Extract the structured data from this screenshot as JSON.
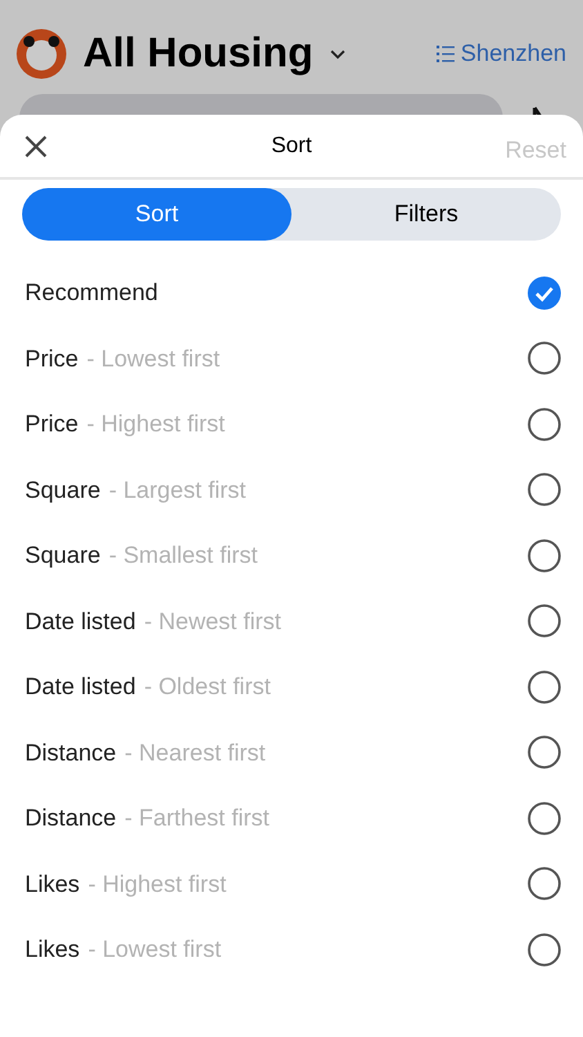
{
  "header": {
    "title": "All Housing",
    "city": "Shenzhen"
  },
  "sheet": {
    "title": "Sort",
    "reset": "Reset",
    "tabs": [
      {
        "label": "Sort",
        "selected": true
      },
      {
        "label": "Filters",
        "selected": false
      }
    ],
    "options": [
      {
        "label": "Recommend",
        "selected": true
      },
      {
        "label": "Price",
        "detail": "- Lowest first",
        "selected": false
      },
      {
        "label": "Price",
        "detail": "- Highest first",
        "selected": false
      },
      {
        "label": "Square",
        "detail": "- Largest first",
        "selected": false
      },
      {
        "label": "Square",
        "detail": "- Smallest first",
        "selected": false
      },
      {
        "label": "Date listed",
        "detail": "- Newest first",
        "selected": false
      },
      {
        "label": "Date listed",
        "detail": "- Oldest first",
        "selected": false
      },
      {
        "label": "Distance",
        "detail": "- Nearest first",
        "selected": false
      },
      {
        "label": "Distance",
        "detail": "- Farthest first",
        "selected": false
      },
      {
        "label": "Likes",
        "detail": "- Highest first",
        "selected": false
      },
      {
        "label": "Likes",
        "detail": "- Lowest first",
        "selected": false
      }
    ]
  }
}
